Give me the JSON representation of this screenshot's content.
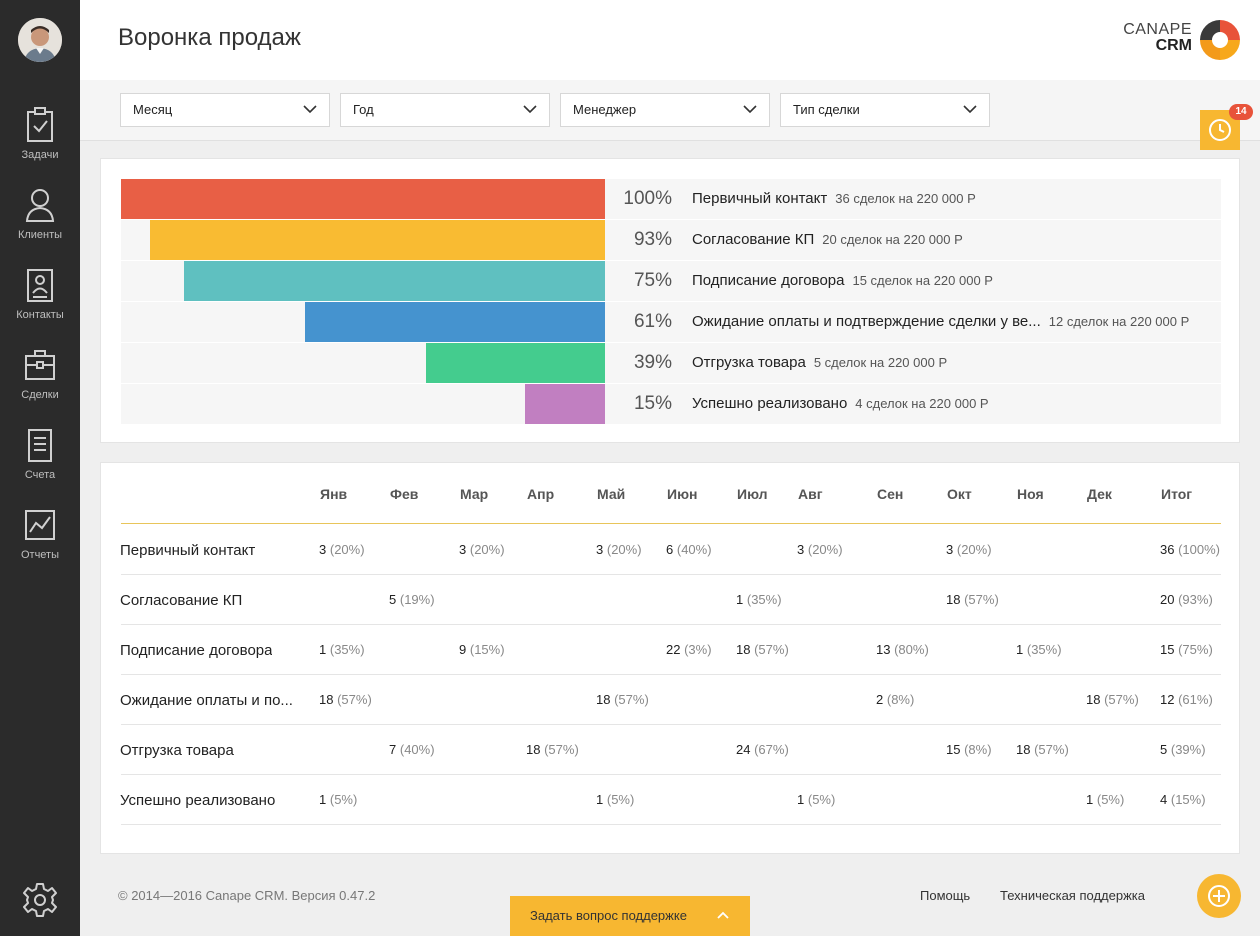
{
  "header": {
    "title": "Воронка продаж"
  },
  "logo": {
    "top": "CANAPE",
    "bottom": "CRM"
  },
  "sidebar": {
    "items": [
      {
        "label": "Задачи",
        "icon": "tasks-icon"
      },
      {
        "label": "Клиенты",
        "icon": "clients-icon"
      },
      {
        "label": "Контакты",
        "icon": "contacts-icon"
      },
      {
        "label": "Сделки",
        "icon": "deals-icon"
      },
      {
        "label": "Счета",
        "icon": "invoices-icon"
      },
      {
        "label": "Отчеты",
        "icon": "reports-icon"
      }
    ]
  },
  "filters": [
    "Месяц",
    "Год",
    "Менеджер",
    "Тип сделки"
  ],
  "timer": {
    "badge": "14"
  },
  "colors": {
    "accent": "#f7b731",
    "stage1": "#e85f45",
    "stage2": "#f9bb32",
    "stage3": "#5fc0c0",
    "stage4": "#4593cf",
    "stage5": "#44cc8e",
    "stage6": "#c17fc1"
  },
  "funnel": [
    {
      "pct": "100%",
      "fraction": 1.0,
      "name": "Первичный контакт",
      "info": "36 сделок на 220 000 Р"
    },
    {
      "pct": "93%",
      "fraction": 0.94,
      "name": "Согласование КП",
      "info": "20 сделок на 220 000 Р"
    },
    {
      "pct": "75%",
      "fraction": 0.87,
      "name": "Подписание договора",
      "info": "15 сделок на 220 000 Р"
    },
    {
      "pct": "61%",
      "fraction": 0.62,
      "name": "Ожидание оплаты и подтверждение сделки у ве...",
      "info": "12 сделок на 220 000 Р"
    },
    {
      "pct": "39%",
      "fraction": 0.37,
      "name": "Отгрузка товара",
      "info": "5 сделок на 220 000 Р"
    },
    {
      "pct": "15%",
      "fraction": 0.165,
      "name": "Успешно реализовано",
      "info": "4 сделок на 220 000 Р"
    }
  ],
  "table": {
    "columns": [
      "Янв",
      "Фев",
      "Мар",
      "Апр",
      "Май",
      "Июн",
      "Июл",
      "Авг",
      "Сен",
      "Окт",
      "Ноя",
      "Дек",
      "Итог"
    ],
    "rows": [
      {
        "label": "Первичный контакт",
        "cells": [
          [
            "3",
            "(20%)"
          ],
          null,
          [
            "3",
            "(20%)"
          ],
          null,
          [
            "3",
            "(20%)"
          ],
          [
            "6",
            "(40%)"
          ],
          null,
          [
            "3",
            "(20%)"
          ],
          null,
          [
            "3",
            "(20%)"
          ],
          null,
          null,
          [
            "36",
            "(100%)"
          ]
        ]
      },
      {
        "label": "Согласование КП",
        "cells": [
          null,
          [
            "5",
            "(19%)"
          ],
          null,
          null,
          null,
          null,
          [
            "1",
            "(35%)"
          ],
          null,
          null,
          [
            "18",
            "(57%)"
          ],
          null,
          null,
          [
            "20",
            "(93%)"
          ]
        ]
      },
      {
        "label": "Подписание договора",
        "cells": [
          [
            "1",
            "(35%)"
          ],
          null,
          [
            "9",
            "(15%)"
          ],
          null,
          null,
          [
            "22",
            "(3%)"
          ],
          [
            "18",
            "(57%)"
          ],
          null,
          [
            "13",
            "(80%)"
          ],
          null,
          [
            "1",
            "(35%)"
          ],
          null,
          [
            "15",
            "(75%)"
          ]
        ]
      },
      {
        "label": "Ожидание оплаты и по...",
        "cells": [
          [
            "18",
            "(57%)"
          ],
          null,
          null,
          null,
          [
            "18",
            "(57%)"
          ],
          null,
          null,
          null,
          [
            "2",
            "(8%)"
          ],
          null,
          null,
          [
            "18",
            "(57%)"
          ],
          [
            "12",
            "(61%)"
          ]
        ]
      },
      {
        "label": "Отгрузка товара",
        "cells": [
          null,
          [
            "7",
            "(40%)"
          ],
          null,
          [
            "18",
            "(57%)"
          ],
          null,
          null,
          [
            "24",
            "(67%)"
          ],
          null,
          null,
          [
            "15",
            "(8%)"
          ],
          [
            "18",
            "(57%)"
          ],
          null,
          [
            "5",
            "(39%)"
          ]
        ]
      },
      {
        "label": "Успешно реализовано",
        "cells": [
          [
            "1",
            "(5%)"
          ],
          null,
          null,
          null,
          [
            "1",
            "(5%)"
          ],
          null,
          null,
          [
            "1",
            "(5%)"
          ],
          null,
          null,
          null,
          [
            "1",
            "(5%)"
          ],
          [
            "4",
            "(15%)"
          ]
        ]
      }
    ]
  },
  "footer": {
    "copyright": "© 2014—2016  Canape CRM. Версия 0.47.2",
    "help": "Помощь",
    "support": "Техническая поддержка",
    "ask_button": "Задать вопрос поддержке"
  }
}
